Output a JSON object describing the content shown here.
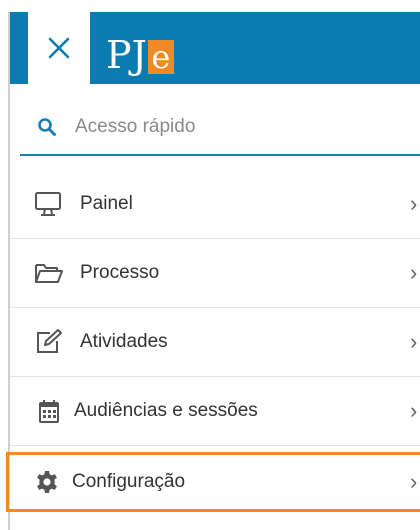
{
  "header": {
    "logo_text": "PJe",
    "brand_color": "#0b7cb0",
    "logo_accent_color": "#f08a24"
  },
  "search": {
    "placeholder": "Acesso rápido",
    "icon": "search-icon"
  },
  "menu": {
    "items": [
      {
        "label": "Painel",
        "icon": "monitor-icon"
      },
      {
        "label": "Processo",
        "icon": "folder-open-icon"
      },
      {
        "label": "Atividades",
        "icon": "edit-icon"
      },
      {
        "label": "Audiências e sessões",
        "icon": "calendar-icon"
      },
      {
        "label": "Configuração",
        "icon": "gear-icon",
        "highlighted": true
      }
    ],
    "chevron": "›",
    "highlight_color": "#f08a24"
  }
}
